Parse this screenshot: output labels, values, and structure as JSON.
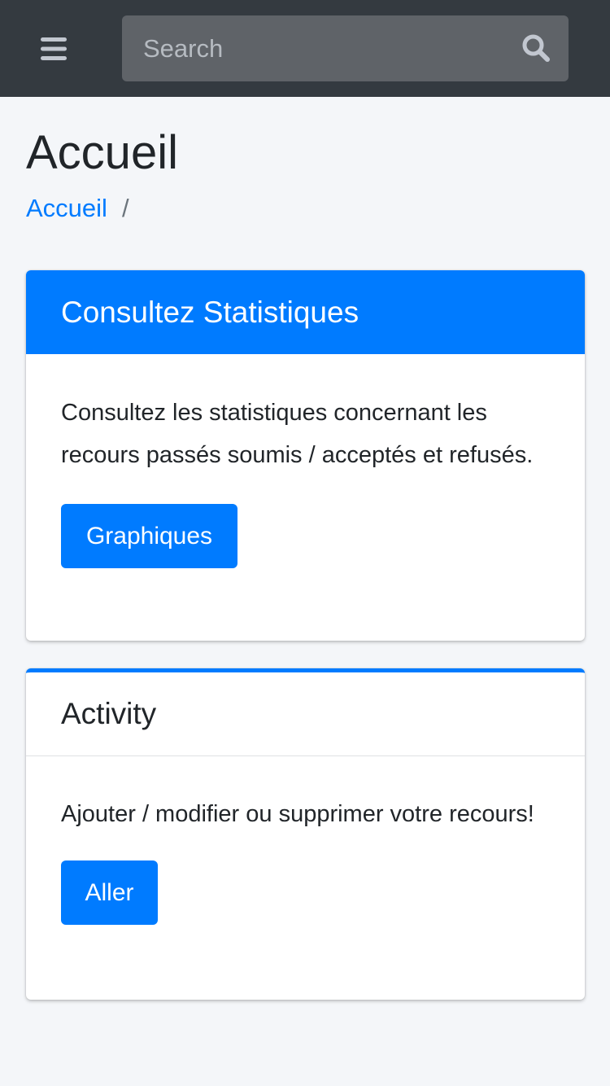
{
  "navbar": {
    "menu_icon": "hamburger-menu-icon",
    "search": {
      "placeholder": "Search",
      "value": "",
      "icon": "search-icon"
    }
  },
  "header": {
    "title": "Accueil",
    "breadcrumb": {
      "items": [
        "Accueil"
      ],
      "separator": "/"
    }
  },
  "cards": [
    {
      "title": "Consultez Statistiques",
      "text": "Consultez les statistiques concernant les recours passés soumis / acceptés et refusés.",
      "button_label": "Graphiques"
    },
    {
      "title": "Activity",
      "text": "Ajouter / modifier ou supprimer votre recours!",
      "button_label": "Aller"
    }
  ],
  "colors": {
    "navbar_bg": "#343a40",
    "primary": "#007bff",
    "page_bg": "#f4f6f9",
    "text": "#212529"
  }
}
